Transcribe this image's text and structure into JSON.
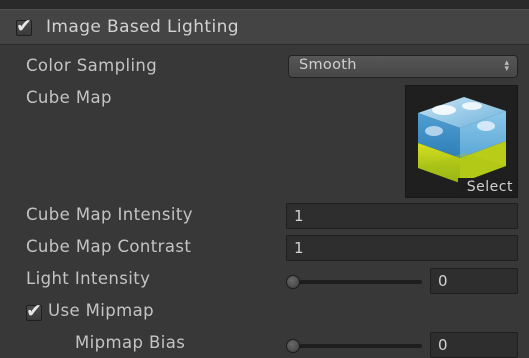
{
  "section": {
    "title": "Image Based Lighting",
    "enabled": true
  },
  "color_sampling": {
    "label": "Color Sampling",
    "value": "Smooth",
    "arrow": "▴\n▾"
  },
  "cube_map": {
    "label": "Cube Map",
    "thumbnail_icon": "cubemap-preview-icon",
    "select_label": "Select"
  },
  "cube_map_intensity": {
    "label": "Cube Map Intensity",
    "value": "1"
  },
  "cube_map_contrast": {
    "label": "Cube Map Contrast",
    "value": "1"
  },
  "light_intensity": {
    "label": "Light Intensity",
    "value": "0",
    "level": 0
  },
  "use_mipmap": {
    "label": "Use Mipmap",
    "checked": true
  },
  "mipmap_bias": {
    "label": "Mipmap Bias",
    "value": "0",
    "level": 0
  },
  "colors": {
    "panel_bg": "#383838",
    "header_bg": "#444444",
    "field_bg": "#2e2e2e",
    "text": "#c4c4c4"
  }
}
